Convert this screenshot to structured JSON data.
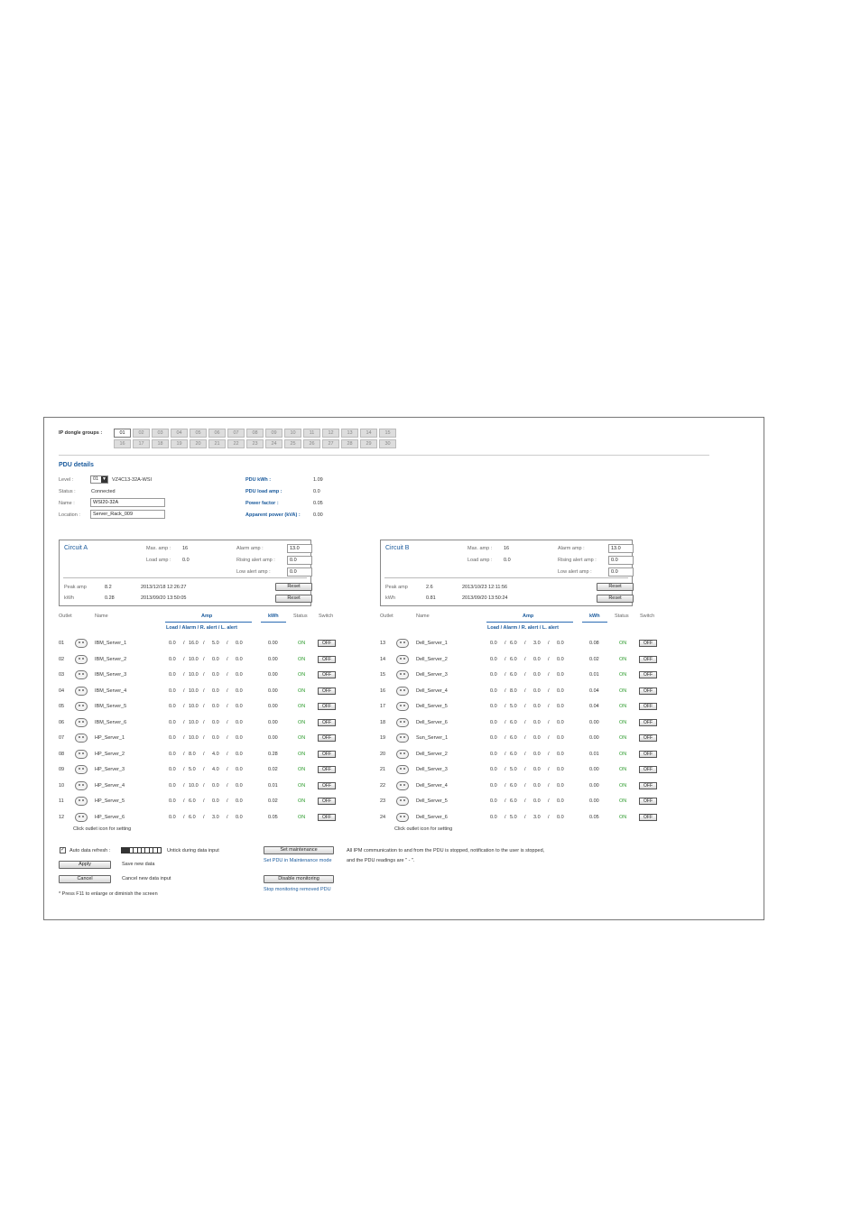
{
  "header": {
    "groups_label": "IP dongle groups :",
    "groups_row1": [
      "01",
      "02",
      "03",
      "04",
      "05",
      "06",
      "07",
      "08",
      "09",
      "10",
      "11",
      "12",
      "13",
      "14",
      "15"
    ],
    "groups_row2": [
      "16",
      "17",
      "18",
      "19",
      "20",
      "21",
      "22",
      "23",
      "24",
      "25",
      "26",
      "27",
      "28",
      "29",
      "30"
    ],
    "active_group": "01"
  },
  "pdu_details": {
    "title": "PDU details",
    "level_label": "Level :",
    "level_value": "01",
    "model": "VZ4C13-32A-WSI",
    "status_label": "Status :",
    "status_value": "Connected",
    "name_label": "Name :",
    "name_value": "WSI20-32A",
    "location_label": "Location :",
    "location_value": "Server_Rack_009",
    "kwh_label": "PDU kWh :",
    "kwh_value": "1.09",
    "load_amp_label": "PDU load amp :",
    "load_amp_value": "0.0",
    "power_factor_label": "Power factor :",
    "power_factor_value": "0.05",
    "apparent_power_label": "Apparent power (kVA) :",
    "apparent_power_value": "0.00"
  },
  "circuits": [
    {
      "title": "Circuit A",
      "max_amp_label": "Max. amp :",
      "max_amp": "16",
      "load_amp_label": "Load amp :",
      "load_amp": "0.0",
      "alarm_amp_label": "Alarm amp :",
      "alarm_amp": "13.0",
      "rising_label": "Rising alert amp :",
      "rising": "0.0",
      "low_label": "Low alert amp :",
      "low": "0.0",
      "peak_label": "Peak amp",
      "peak": "8.2",
      "peak_time": "2013/12/18 12:26:27",
      "kwh_label": "kWh",
      "kwh": "0.28",
      "kwh_time": "2013/09/20 13:50:05",
      "reset_label": "Reset"
    },
    {
      "title": "Circuit B",
      "max_amp_label": "Max. amp :",
      "max_amp": "16",
      "load_amp_label": "Load amp :",
      "load_amp": "0.0",
      "alarm_amp_label": "Alarm amp :",
      "alarm_amp": "13.0",
      "rising_label": "Rising alert amp :",
      "rising": "0.0",
      "low_label": "Low alert amp :",
      "low": "0.0",
      "peak_label": "Peak amp",
      "peak": "2.6",
      "peak_time": "2013/10/23 12:11:56",
      "kwh_label": "kWh",
      "kwh": "0.81",
      "kwh_time": "2013/09/20 13:50:24",
      "reset_label": "Reset"
    }
  ],
  "outlet_headers": {
    "outlet": "Outlet",
    "name": "Name",
    "amp": "Amp",
    "amp_sub": "Load / Alarm / R. alert / L. alert",
    "kwh": "kWh",
    "status": "Status",
    "switch": "Switch",
    "hint": "Click outlet icon for setting"
  },
  "outlets_left": [
    {
      "no": "01",
      "name": "IBM_Server_1",
      "amps": [
        "0.0",
        "16.0",
        "5.0",
        "0.0"
      ],
      "kwh": "0.00",
      "status": "ON",
      "switch": "OFF"
    },
    {
      "no": "02",
      "name": "IBM_Server_2",
      "amps": [
        "0.0",
        "10.0",
        "0.0",
        "0.0"
      ],
      "kwh": "0.00",
      "status": "ON",
      "switch": "OFF"
    },
    {
      "no": "03",
      "name": "IBM_Server_3",
      "amps": [
        "0.0",
        "10.0",
        "0.0",
        "0.0"
      ],
      "kwh": "0.00",
      "status": "ON",
      "switch": "OFF"
    },
    {
      "no": "04",
      "name": "IBM_Server_4",
      "amps": [
        "0.0",
        "10.0",
        "0.0",
        "0.0"
      ],
      "kwh": "0.00",
      "status": "ON",
      "switch": "OFF"
    },
    {
      "no": "05",
      "name": "IBM_Server_5",
      "amps": [
        "0.0",
        "10.0",
        "0.0",
        "0.0"
      ],
      "kwh": "0.00",
      "status": "ON",
      "switch": "OFF"
    },
    {
      "no": "06",
      "name": "IBM_Server_6",
      "amps": [
        "0.0",
        "10.0",
        "0.0",
        "0.0"
      ],
      "kwh": "0.00",
      "status": "ON",
      "switch": "OFF"
    },
    {
      "no": "07",
      "name": "HP_Server_1",
      "amps": [
        "0.0",
        "10.0",
        "0.0",
        "0.0"
      ],
      "kwh": "0.00",
      "status": "ON",
      "switch": "OFF"
    },
    {
      "no": "08",
      "name": "HP_Server_2",
      "amps": [
        "0.0",
        "8.0",
        "4.0",
        "0.0"
      ],
      "kwh": "0.28",
      "status": "ON",
      "switch": "OFF"
    },
    {
      "no": "09",
      "name": "HP_Server_3",
      "amps": [
        "0.0",
        "5.0",
        "4.0",
        "0.0"
      ],
      "kwh": "0.02",
      "status": "ON",
      "switch": "OFF"
    },
    {
      "no": "10",
      "name": "HP_Server_4",
      "amps": [
        "0.0",
        "10.0",
        "0.0",
        "0.0"
      ],
      "kwh": "0.01",
      "status": "ON",
      "switch": "OFF"
    },
    {
      "no": "11",
      "name": "HP_Server_5",
      "amps": [
        "0.0",
        "6.0",
        "0.0",
        "0.0"
      ],
      "kwh": "0.02",
      "status": "ON",
      "switch": "OFF"
    },
    {
      "no": "12",
      "name": "HP_Server_6",
      "amps": [
        "0.0",
        "6.0",
        "3.0",
        "0.0"
      ],
      "kwh": "0.05",
      "status": "ON",
      "switch": "OFF"
    }
  ],
  "outlets_right": [
    {
      "no": "13",
      "name": "Dell_Server_1",
      "amps": [
        "0.0",
        "6.0",
        "3.0",
        "0.0"
      ],
      "kwh": "0.08",
      "status": "ON",
      "switch": "OFF"
    },
    {
      "no": "14",
      "name": "Dell_Server_2",
      "amps": [
        "0.0",
        "6.0",
        "0.0",
        "0.0"
      ],
      "kwh": "0.02",
      "status": "ON",
      "switch": "OFF"
    },
    {
      "no": "15",
      "name": "Dell_Server_3",
      "amps": [
        "0.0",
        "6.0",
        "0.0",
        "0.0"
      ],
      "kwh": "0.01",
      "status": "ON",
      "switch": "OFF"
    },
    {
      "no": "16",
      "name": "Dell_Server_4",
      "amps": [
        "0.0",
        "8.0",
        "0.0",
        "0.0"
      ],
      "kwh": "0.04",
      "status": "ON",
      "switch": "OFF"
    },
    {
      "no": "17",
      "name": "Dell_Server_5",
      "amps": [
        "0.0",
        "5.0",
        "0.0",
        "0.0"
      ],
      "kwh": "0.04",
      "status": "ON",
      "switch": "OFF"
    },
    {
      "no": "18",
      "name": "Dell_Server_6",
      "amps": [
        "0.0",
        "6.0",
        "0.0",
        "0.0"
      ],
      "kwh": "0.00",
      "status": "ON",
      "switch": "OFF"
    },
    {
      "no": "19",
      "name": "Sun_Server_1",
      "amps": [
        "0.0",
        "6.0",
        "0.0",
        "0.0"
      ],
      "kwh": "0.00",
      "status": "ON",
      "switch": "OFF"
    },
    {
      "no": "20",
      "name": "Dell_Server_2",
      "amps": [
        "0.0",
        "6.0",
        "0.0",
        "0.0"
      ],
      "kwh": "0.01",
      "status": "ON",
      "switch": "OFF"
    },
    {
      "no": "21",
      "name": "Dell_Server_3",
      "amps": [
        "0.0",
        "5.0",
        "0.0",
        "0.0"
      ],
      "kwh": "0.00",
      "status": "ON",
      "switch": "OFF"
    },
    {
      "no": "22",
      "name": "Dell_Server_4",
      "amps": [
        "0.0",
        "6.0",
        "0.0",
        "0.0"
      ],
      "kwh": "0.00",
      "status": "ON",
      "switch": "OFF"
    },
    {
      "no": "23",
      "name": "Dell_Server_5",
      "amps": [
        "0.0",
        "6.0",
        "0.0",
        "0.0"
      ],
      "kwh": "0.00",
      "status": "ON",
      "switch": "OFF"
    },
    {
      "no": "24",
      "name": "Dell_Server_6",
      "amps": [
        "0.0",
        "5.0",
        "3.0",
        "0.0"
      ],
      "kwh": "0.05",
      "status": "ON",
      "switch": "OFF"
    }
  ],
  "footer": {
    "auto_refresh_label": "Auto data refresh :",
    "auto_refresh_checked": "✓",
    "refresh_hint": "Untick during data input",
    "apply_label": "Apply",
    "apply_hint": "Save new data",
    "cancel_label": "Cancel",
    "cancel_hint": "Cancel new data input",
    "f11_note": "* Press F11 to enlarge or diminish the screen",
    "maintenance_label": "Set maintenance",
    "maintenance_hint": "Set PDU in Maintenance mode",
    "disable_label": "Disable monitoring",
    "disable_hint": "Stop monitoring removed PDU",
    "note_line1": "All IPM communication to and from the PDU is stopped, notification to the user is stopped,",
    "note_line2": "and the PDU readings are \" - \"."
  }
}
